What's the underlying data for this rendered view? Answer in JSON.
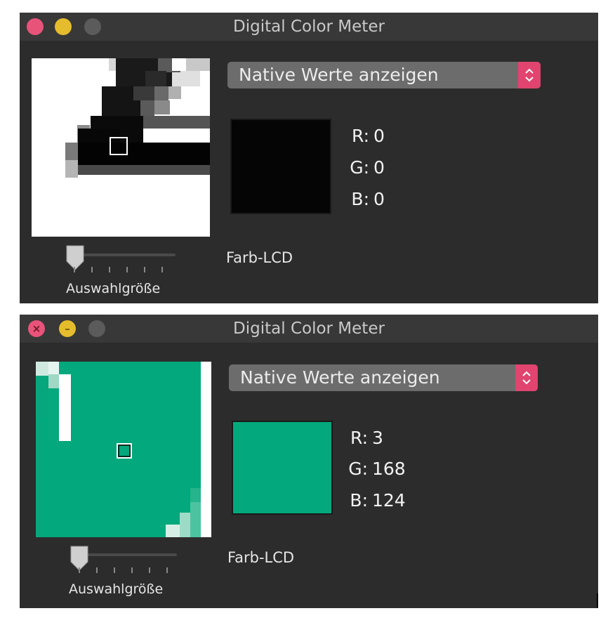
{
  "windows": [
    {
      "title": "Digital Color Meter",
      "mode_select": "Native Werte anzeigen",
      "swatch_color": "#050505",
      "channels": [
        {
          "label": "R:",
          "value": "0"
        },
        {
          "label": "G:",
          "value": "0"
        },
        {
          "label": "B:",
          "value": "0"
        }
      ],
      "display_profile": "Farb-LCD",
      "aperture_label": "Auswahlgröße",
      "traffic_lights_active": true
    },
    {
      "title": "Digital Color Meter",
      "mode_select": "Native Werte anzeigen",
      "swatch_color": "#03a87c",
      "channels": [
        {
          "label": "R:",
          "value": "3"
        },
        {
          "label": "G:",
          "value": "168"
        },
        {
          "label": "B:",
          "value": "124"
        }
      ],
      "display_profile": "Farb-LCD",
      "aperture_label": "Auswahlgröße",
      "traffic_lights_active": true,
      "traffic_lights_hover": true
    }
  ],
  "colors": {
    "window_bg": "#2c2c2c",
    "titlebar_bg": "#383838",
    "accent": "#e0446f",
    "close": "#e8537a",
    "minimize": "#e5bd2c",
    "zoom_inactive": "#5b5b5b"
  }
}
